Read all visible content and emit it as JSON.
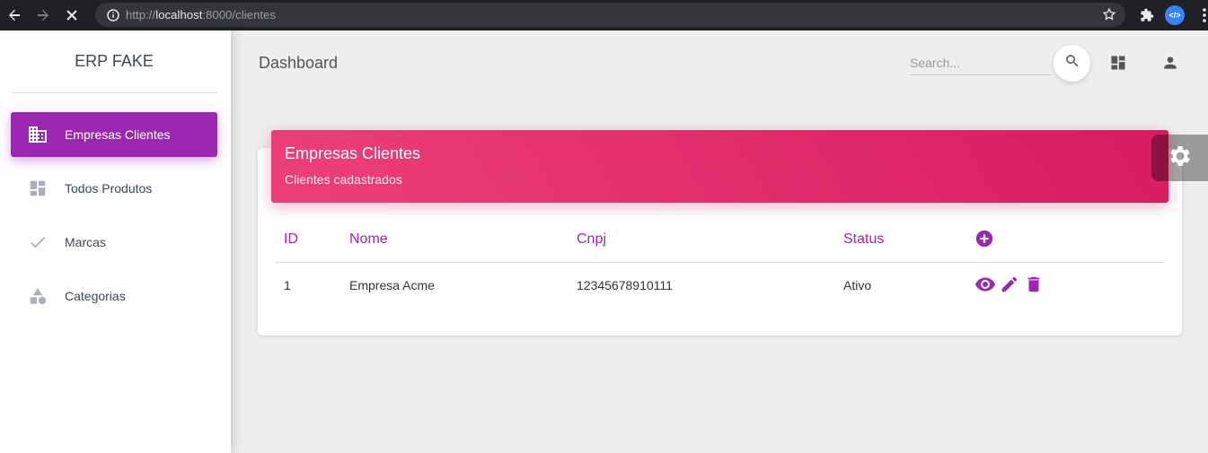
{
  "browser": {
    "url_scheme": "http://",
    "url_host": "localhost",
    "url_rest": ":8000/clientes",
    "icons": [
      "back-icon",
      "forward-icon",
      "stop-icon",
      "info-icon",
      "star-icon",
      "puzzle-icon",
      "dev-extension-icon",
      "menu-icon"
    ],
    "dev_badge": "</>"
  },
  "sidebar": {
    "brand": "ERP FAKE",
    "items": [
      {
        "label": "Empresas Clientes",
        "icon": "business-icon",
        "active": true
      },
      {
        "label": "Todos Produtos",
        "icon": "dashboard-icon",
        "active": false
      },
      {
        "label": "Marcas",
        "icon": "check-icon",
        "active": false
      },
      {
        "label": "Categorias",
        "icon": "category-icon",
        "active": false
      }
    ]
  },
  "topbar": {
    "title": "Dashboard",
    "search_placeholder": "Search..."
  },
  "card": {
    "title": "Empresas Clientes",
    "subtitle": "Clientes cadastrados",
    "columns": [
      "ID",
      "Nome",
      "Cnpj",
      "Status"
    ],
    "rows": [
      {
        "id": "1",
        "nome": "Empresa Acme",
        "cnpj": "12345678910111",
        "status": "Ativo"
      }
    ]
  },
  "colors": {
    "accent": "#9c27b0",
    "header_gradient_start": "#ec407a",
    "header_gradient_end": "#d81b60"
  }
}
